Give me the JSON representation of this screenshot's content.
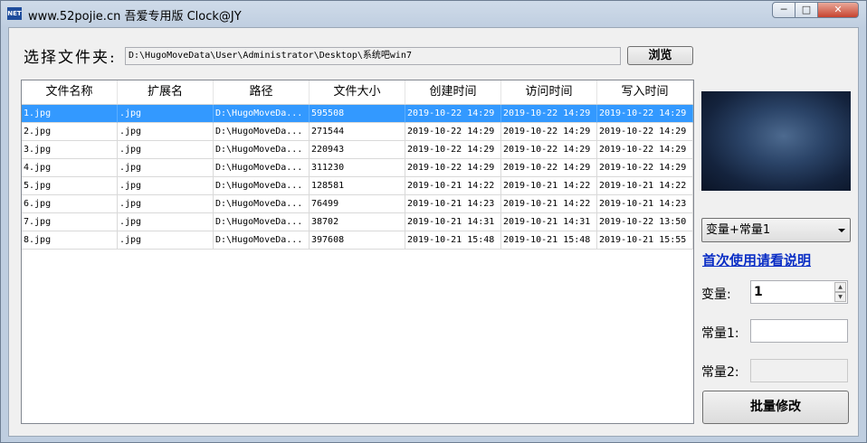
{
  "window": {
    "app_icon_text": "NET",
    "title": "www.52pojie.cn 吾爱专用版   Clock@JY",
    "min_glyph": "─",
    "max_glyph": "□",
    "close_glyph": "✕"
  },
  "folder": {
    "label": "选择文件夹:",
    "path": "D:\\HugoMoveData\\User\\Administrator\\Desktop\\系统吧win7",
    "browse_label": "浏览"
  },
  "table": {
    "columns": [
      "文件名称",
      "扩展名",
      "路径",
      "文件大小",
      "创建时间",
      "访问时间",
      "写入时间"
    ],
    "rows": [
      [
        "1.jpg",
        ".jpg",
        "D:\\HugoMoveDa...",
        "595508",
        "2019-10-22 14:29",
        "2019-10-22 14:29",
        "2019-10-22 14:29"
      ],
      [
        "2.jpg",
        ".jpg",
        "D:\\HugoMoveDa...",
        "271544",
        "2019-10-22 14:29",
        "2019-10-22 14:29",
        "2019-10-22 14:29"
      ],
      [
        "3.jpg",
        ".jpg",
        "D:\\HugoMoveDa...",
        "220943",
        "2019-10-22 14:29",
        "2019-10-22 14:29",
        "2019-10-22 14:29"
      ],
      [
        "4.jpg",
        ".jpg",
        "D:\\HugoMoveDa...",
        "311230",
        "2019-10-22 14:29",
        "2019-10-22 14:29",
        "2019-10-22 14:29"
      ],
      [
        "5.jpg",
        ".jpg",
        "D:\\HugoMoveDa...",
        "128581",
        "2019-10-21 14:22",
        "2019-10-21 14:22",
        "2019-10-21 14:22"
      ],
      [
        "6.jpg",
        ".jpg",
        "D:\\HugoMoveDa...",
        "76499",
        "2019-10-21 14:23",
        "2019-10-21 14:22",
        "2019-10-21 14:23"
      ],
      [
        "7.jpg",
        ".jpg",
        "D:\\HugoMoveDa...",
        "38702",
        "2019-10-21 14:31",
        "2019-10-21 14:31",
        "2019-10-22 13:50"
      ],
      [
        "8.jpg",
        ".jpg",
        "D:\\HugoMoveDa...",
        "397608",
        "2019-10-21 15:48",
        "2019-10-21 15:48",
        "2019-10-21 15:55"
      ]
    ],
    "selected_row": 0
  },
  "side": {
    "mode_selected": "变量+常量1",
    "help_link": "首次使用请看说明",
    "var_label": "变量:",
    "var_value": "1",
    "const1_label": "常量1:",
    "const1_value": "",
    "const2_label": "常量2:",
    "const2_value": "",
    "batch_label": "批量修改",
    "spin_up": "▲",
    "spin_down": "▼"
  },
  "colors": {
    "selection": "#3399ff",
    "link": "#0a2ec5"
  }
}
